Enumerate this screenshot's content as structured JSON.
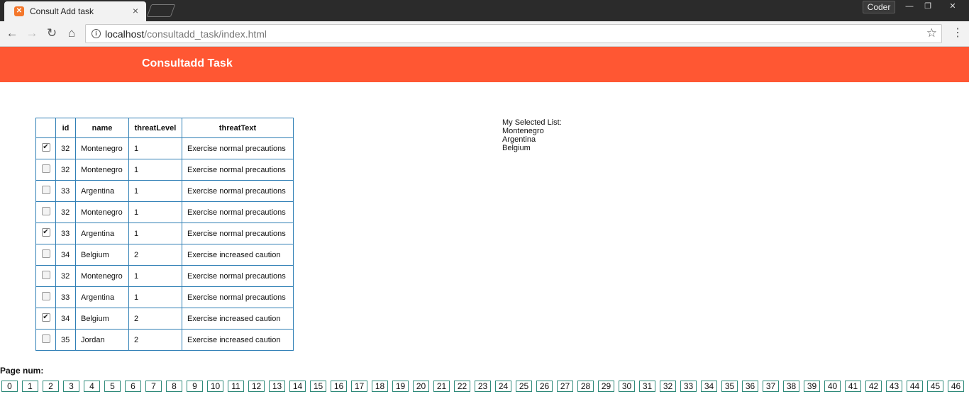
{
  "browser": {
    "tab_title": "Consult Add task",
    "tab_close": "×",
    "profile": "Coder",
    "url_host": "localhost",
    "url_path": "/consultadd_task/index.html",
    "win_min": "—",
    "win_max": "❐",
    "win_close": "✕",
    "icons": {
      "back": "←",
      "forward": "→",
      "reload": "↻",
      "home": "⌂",
      "info": "i",
      "star": "☆",
      "menu": "⋮"
    }
  },
  "header": {
    "title": "Consultadd Task",
    "color": "#ff5733"
  },
  "table": {
    "columns": [
      "",
      "id",
      "name",
      "threatLevel",
      "threatText"
    ],
    "rows": [
      {
        "checked": true,
        "id": "32",
        "name": "Montenegro",
        "threatLevel": "1",
        "threatText": "Exercise normal precautions"
      },
      {
        "checked": false,
        "id": "32",
        "name": "Montenegro",
        "threatLevel": "1",
        "threatText": "Exercise normal precautions"
      },
      {
        "checked": false,
        "id": "33",
        "name": "Argentina",
        "threatLevel": "1",
        "threatText": "Exercise normal precautions"
      },
      {
        "checked": false,
        "id": "32",
        "name": "Montenegro",
        "threatLevel": "1",
        "threatText": "Exercise normal precautions"
      },
      {
        "checked": true,
        "id": "33",
        "name": "Argentina",
        "threatLevel": "1",
        "threatText": "Exercise normal precautions"
      },
      {
        "checked": false,
        "id": "34",
        "name": "Belgium",
        "threatLevel": "2",
        "threatText": "Exercise increased caution"
      },
      {
        "checked": false,
        "id": "32",
        "name": "Montenegro",
        "threatLevel": "1",
        "threatText": "Exercise normal precautions"
      },
      {
        "checked": false,
        "id": "33",
        "name": "Argentina",
        "threatLevel": "1",
        "threatText": "Exercise normal precautions"
      },
      {
        "checked": true,
        "id": "34",
        "name": "Belgium",
        "threatLevel": "2",
        "threatText": "Exercise increased caution"
      },
      {
        "checked": false,
        "id": "35",
        "name": "Jordan",
        "threatLevel": "2",
        "threatText": "Exercise increased caution"
      }
    ]
  },
  "selected": {
    "title": "My Selected List:",
    "items": [
      "Montenegro",
      "Argentina",
      "Belgium"
    ]
  },
  "pagination": {
    "label": "Page num:",
    "pages": [
      "0",
      "1",
      "2",
      "3",
      "4",
      "5",
      "6",
      "7",
      "8",
      "9",
      "10",
      "11",
      "12",
      "13",
      "14",
      "15",
      "16",
      "17",
      "18",
      "19",
      "20",
      "21",
      "22",
      "23",
      "24",
      "25",
      "26",
      "27",
      "28",
      "29",
      "30",
      "31",
      "32",
      "33",
      "34",
      "35",
      "36",
      "37",
      "38",
      "39",
      "40",
      "41",
      "42",
      "43",
      "44",
      "45",
      "46"
    ]
  }
}
